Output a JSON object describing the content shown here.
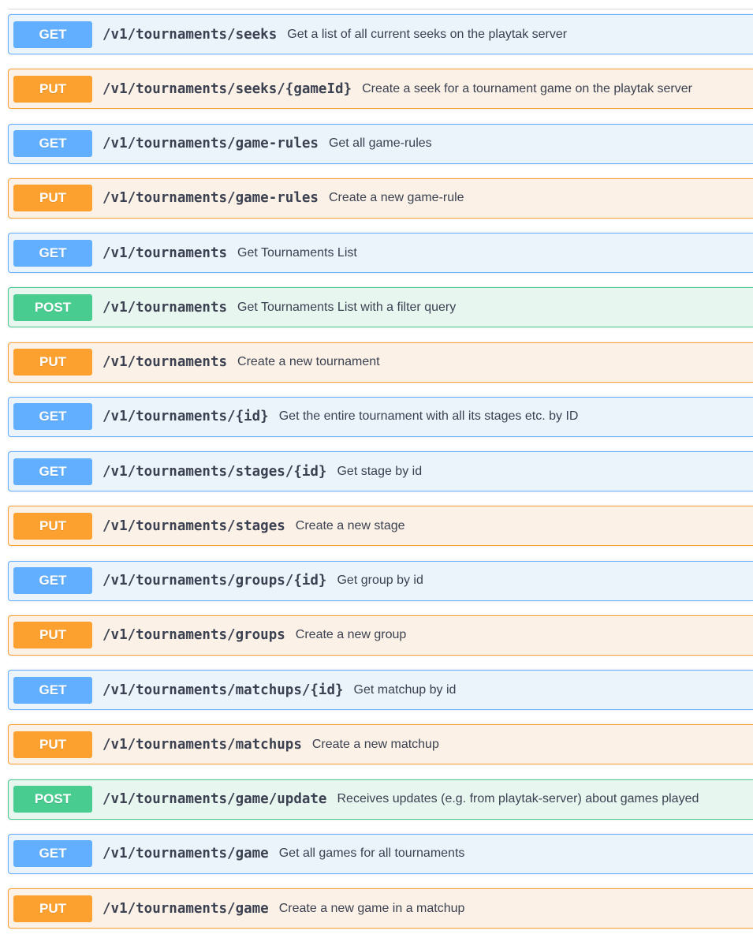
{
  "operations": [
    {
      "method": "GET",
      "path": "/v1/tournaments/seeks",
      "summary": "Get a list of all current seeks on the playtak server"
    },
    {
      "method": "PUT",
      "path": "/v1/tournaments/seeks/{gameId}",
      "summary": "Create a seek for a tournament game on the playtak server"
    },
    {
      "method": "GET",
      "path": "/v1/tournaments/game-rules",
      "summary": "Get all game-rules"
    },
    {
      "method": "PUT",
      "path": "/v1/tournaments/game-rules",
      "summary": "Create a new game-rule"
    },
    {
      "method": "GET",
      "path": "/v1/tournaments",
      "summary": "Get Tournaments List"
    },
    {
      "method": "POST",
      "path": "/v1/tournaments",
      "summary": "Get Tournaments List with a filter query"
    },
    {
      "method": "PUT",
      "path": "/v1/tournaments",
      "summary": "Create a new tournament"
    },
    {
      "method": "GET",
      "path": "/v1/tournaments/{id}",
      "summary": "Get the entire tournament with all its stages etc. by ID"
    },
    {
      "method": "GET",
      "path": "/v1/tournaments/stages/{id}",
      "summary": "Get stage by id"
    },
    {
      "method": "PUT",
      "path": "/v1/tournaments/stages",
      "summary": "Create a new stage"
    },
    {
      "method": "GET",
      "path": "/v1/tournaments/groups/{id}",
      "summary": "Get group by id"
    },
    {
      "method": "PUT",
      "path": "/v1/tournaments/groups",
      "summary": "Create a new group"
    },
    {
      "method": "GET",
      "path": "/v1/tournaments/matchups/{id}",
      "summary": "Get matchup by id"
    },
    {
      "method": "PUT",
      "path": "/v1/tournaments/matchups",
      "summary": "Create a new matchup"
    },
    {
      "method": "POST",
      "path": "/v1/tournaments/game/update",
      "summary": "Receives updates (e.g. from playtak-server) about games played"
    },
    {
      "method": "GET",
      "path": "/v1/tournaments/game",
      "summary": "Get all games for all tournaments"
    },
    {
      "method": "PUT",
      "path": "/v1/tournaments/game",
      "summary": "Create a new game in a matchup"
    }
  ],
  "colors": {
    "get": "#61affe",
    "put": "#fca130",
    "post": "#49cc90",
    "text": "#3b4151"
  }
}
